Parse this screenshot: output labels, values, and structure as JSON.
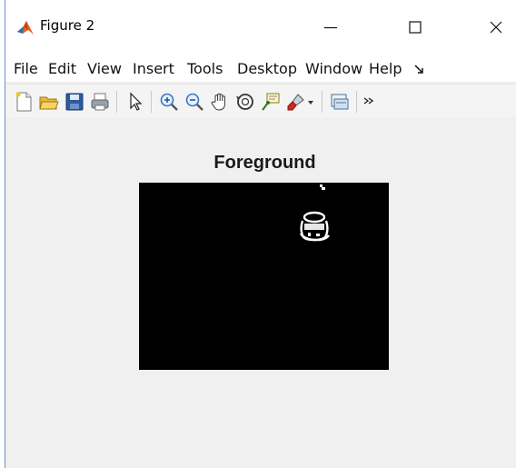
{
  "window": {
    "title": "Figure 2",
    "controls": {
      "minimize": "minimize-icon",
      "maximize": "maximize-icon",
      "close": "close-icon"
    }
  },
  "menu": {
    "items": [
      "File",
      "Edit",
      "View",
      "Insert",
      "Tools",
      "Desktop",
      "Window",
      "Help"
    ]
  },
  "toolbar": {
    "buttons": [
      "new-figure-icon",
      "open-file-icon",
      "save-icon",
      "print-icon",
      "pointer-icon",
      "zoom-in-icon",
      "zoom-out-icon",
      "pan-hand-icon",
      "rotate-3d-icon",
      "data-cursor-icon",
      "brush-icon",
      "dropdown-arrow-icon",
      "link-plot-icon",
      "overflow-chevron-icon"
    ]
  },
  "axes": {
    "title": "Foreground",
    "image_background": "#000000",
    "blob_color": "#ffffff"
  },
  "colors": {
    "matlab_orange": "#e8611c",
    "window_border": "#6a8fd3",
    "panel_bg": "#f0f0f0"
  }
}
